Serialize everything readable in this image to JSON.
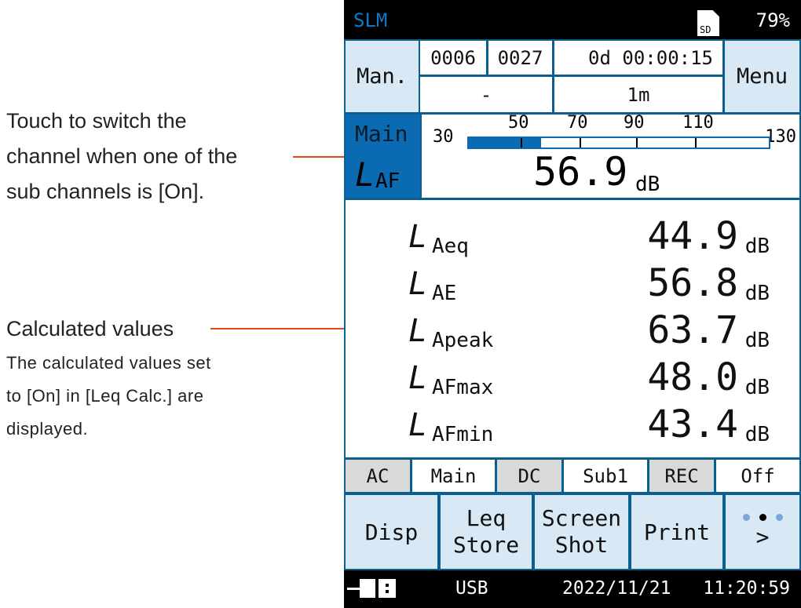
{
  "annotations": {
    "channel": [
      "Touch to switch the",
      "channel when one of the",
      "sub channels is [On]."
    ],
    "calc_title": "Calculated values",
    "calc_desc": [
      "The calculated values set",
      "to [On] in [Leq Calc.] are",
      "displayed."
    ]
  },
  "titlebar": {
    "app": "SLM",
    "sd_label": "SD",
    "battery": "79%"
  },
  "header": {
    "mode_button": "Man.",
    "counter1": "0006",
    "counter2": "0027",
    "elapsed": "0d 00:00:15",
    "field_dash": "-",
    "interval": "1m",
    "menu_button": "Menu"
  },
  "main": {
    "channel": "Main",
    "symbol": "L",
    "weighting": "AF",
    "scale_min": "30",
    "ticks": [
      "50",
      "70",
      "90",
      "110"
    ],
    "scale_max": "130",
    "value": "56.9",
    "unit": "dB",
    "bar_level_db": 56.9
  },
  "values": [
    {
      "symbol": "L",
      "sub": "Aeq",
      "value": "44.9",
      "unit": "dB"
    },
    {
      "symbol": "L",
      "sub": "AE",
      "value": "56.8",
      "unit": "dB"
    },
    {
      "symbol": "L",
      "sub": "Apeak",
      "value": "63.7",
      "unit": "dB"
    },
    {
      "symbol": "L",
      "sub": "AFmax",
      "value": "48.0",
      "unit": "dB"
    },
    {
      "symbol": "L",
      "sub": "AFmin",
      "value": "43.4",
      "unit": "dB"
    }
  ],
  "status": [
    "AC",
    "Main",
    "DC",
    "Sub1",
    "REC",
    "Off"
  ],
  "buttons": {
    "disp": "Disp",
    "leq1": "Leq",
    "leq2": "Store",
    "shot1": "Screen",
    "shot2": "Shot",
    "print": "Print",
    "more": ">"
  },
  "footer": {
    "usb": "USB",
    "date": "2022/11/21",
    "time": "11:20:59"
  },
  "colors": {
    "frame": "#0b5f8e",
    "accent": "#0a6bb3",
    "button": "#d8e8f4",
    "leader_line": "#e2471c"
  }
}
